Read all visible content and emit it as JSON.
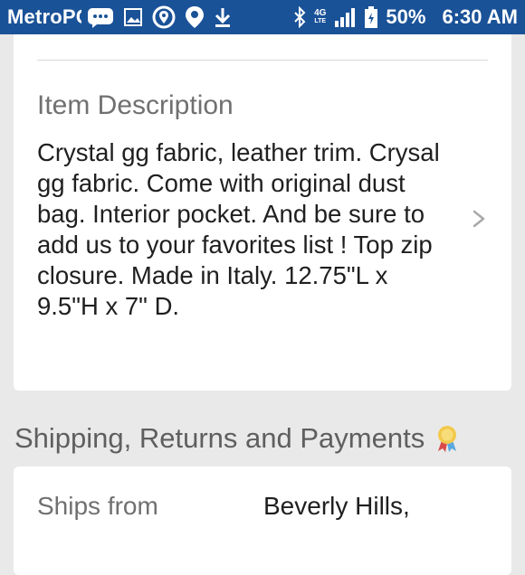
{
  "status_bar": {
    "carrier": "MetroPCS",
    "battery": "50%",
    "time": "6:30 AM",
    "background_color": "#1a5298",
    "icons": [
      "message-icon",
      "gallery-icon",
      "location-icon",
      "location-pin-icon",
      "download-icon",
      "bluetooth-icon",
      "4g-lte-icon",
      "signal-icon",
      "battery-icon"
    ],
    "network_label": "4G",
    "network_sub_label": "LTE"
  },
  "item": {
    "description_label": "Item Description",
    "description_text": "Crystal gg fabric, leather trim. Crysal gg fabric. Come with original dust bag. Interior pocket. And be sure to add us to your favorites list ! Top zip closure. Made in Italy. 12.75\"L x 9.5\"H x 7\" D."
  },
  "shipping": {
    "heading": "Shipping, Returns and Payments",
    "heading_icon": "badge-icon",
    "ships_from_label": "Ships from",
    "ships_from_value": "Beverly Hills,"
  }
}
